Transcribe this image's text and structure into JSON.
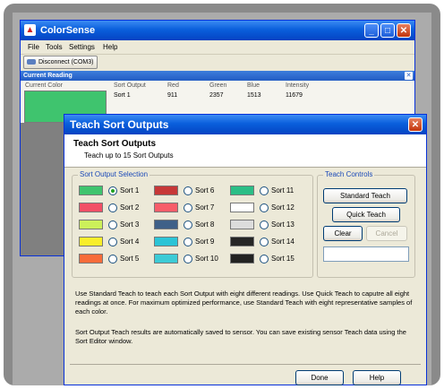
{
  "main_window": {
    "title": "ColorSense",
    "menu": [
      "File",
      "Tools",
      "Settings",
      "Help"
    ],
    "toolbar_button": "Disconnect (COM3)",
    "panel_title": "Current Reading",
    "current_color_label": "Current Color",
    "current_color": "#3fc46e",
    "columns": [
      {
        "header": "Sort Output",
        "value": "Sort 1"
      },
      {
        "header": "Red",
        "value": "911"
      },
      {
        "header": "Green",
        "value": "2357"
      },
      {
        "header": "Blue",
        "value": "1513"
      },
      {
        "header": "Intensity",
        "value": "11679"
      }
    ]
  },
  "dialog": {
    "title": "Teach Sort Outputs",
    "heading": "Teach Sort Outputs",
    "subheading": "Teach up to 15 Sort Outputs",
    "sort_group_label": "Sort Output Selection",
    "sorts": [
      {
        "label": "Sort 1",
        "color": "#3fc46e",
        "selected": true
      },
      {
        "label": "Sort 2",
        "color": "#f24f67",
        "selected": false
      },
      {
        "label": "Sort 3",
        "color": "#ccf05a",
        "selected": false
      },
      {
        "label": "Sort 4",
        "color": "#f9ee2a",
        "selected": false
      },
      {
        "label": "Sort 5",
        "color": "#f86c3a",
        "selected": false
      },
      {
        "label": "Sort 6",
        "color": "#c73838",
        "selected": false
      },
      {
        "label": "Sort 7",
        "color": "#f85d6a",
        "selected": false
      },
      {
        "label": "Sort 8",
        "color": "#3f6088",
        "selected": false
      },
      {
        "label": "Sort 9",
        "color": "#2bc4d6",
        "selected": false
      },
      {
        "label": "Sort 10",
        "color": "#3ccbd6",
        "selected": false
      },
      {
        "label": "Sort 11",
        "color": "#2bbe86",
        "selected": false
      },
      {
        "label": "Sort 12",
        "color": "#ffffff",
        "selected": false
      },
      {
        "label": "Sort 13",
        "color": "#dcdcdc",
        "selected": false
      },
      {
        "label": "Sort 14",
        "color": "#262626",
        "selected": false
      },
      {
        "label": "Sort 15",
        "color": "#222222",
        "selected": false
      }
    ],
    "teach_group_label": "Teach Controls",
    "standard_teach": "Standard Teach",
    "quick_teach": "Quick Teach",
    "clear": "Clear",
    "cancel": "Cancel",
    "teach_input_value": "",
    "para1": "Use Standard Teach to teach each Sort Output with eight different readings. Use Quick Teach to caputre all eight readings at once. For maximum optimized performance, use Standard Teach with eight representative samples of each color.",
    "para2": "Sort Output Teach results are automatically saved to sensor.  You can save existing sensor Teach data using the Sort Editor window.",
    "done": "Done",
    "help": "Help"
  }
}
